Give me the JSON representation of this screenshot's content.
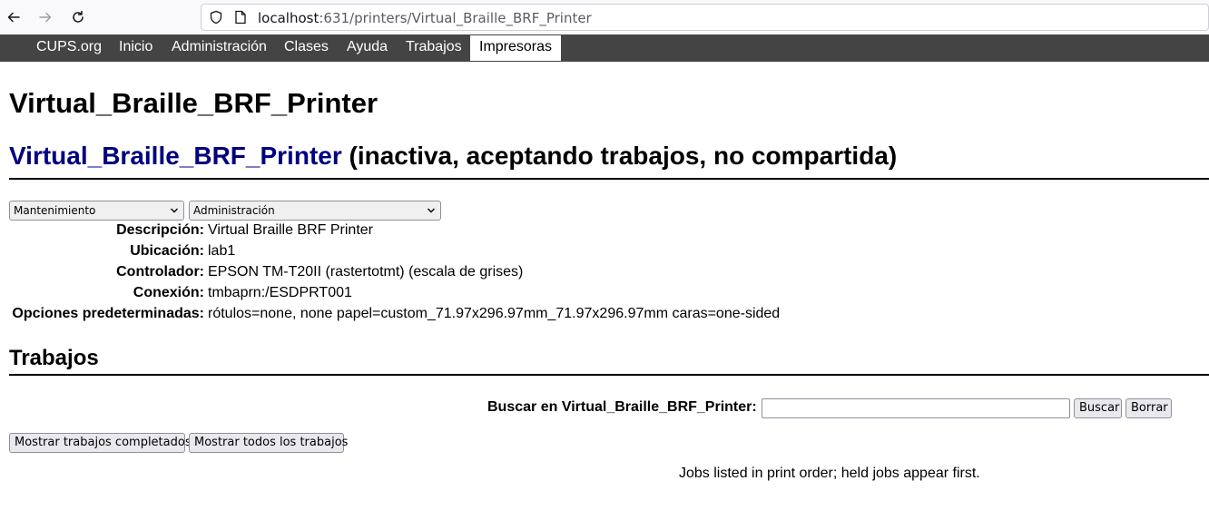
{
  "browser": {
    "url_host": "localhost",
    "url_rest": ":631/printers/Virtual_Braille_BRF_Printer"
  },
  "nav": {
    "items": [
      "CUPS.org",
      "Inicio",
      "Administración",
      "Clases",
      "Ayuda",
      "Trabajos",
      "Impresoras"
    ],
    "active": "Impresoras"
  },
  "page": {
    "title": "Virtual_Braille_BRF_Printer",
    "printer_link": "Virtual_Braille_BRF_Printer",
    "printer_state": " (inactiva, aceptando trabajos, no compartida)"
  },
  "dropdowns": {
    "maintenance": "Mantenimiento",
    "administration": "Administración"
  },
  "details": [
    {
      "label": "Descripción:",
      "value": "Virtual Braille BRF Printer"
    },
    {
      "label": "Ubicación:",
      "value": "lab1"
    },
    {
      "label": "Controlador:",
      "value": "EPSON TM-T20II (rastertotmt) (escala de grises)"
    },
    {
      "label": "Conexión:",
      "value": "tmbaprn:/ESDPRT001"
    },
    {
      "label": "Opciones predeterminadas:",
      "value": "rótulos=none, none papel=custom_71.97x296.97mm_71.97x296.97mm caras=one-sided"
    }
  ],
  "jobs": {
    "section_title": "Trabajos",
    "search_label": "Buscar en Virtual_Braille_BRF_Printer:",
    "search_value": "",
    "search_button": "Buscar",
    "clear_button": "Borrar",
    "show_completed": "Mostrar trabajos completados",
    "show_all": "Mostrar todos los trabajos",
    "note": "Jobs listed in print order; held jobs appear first."
  }
}
